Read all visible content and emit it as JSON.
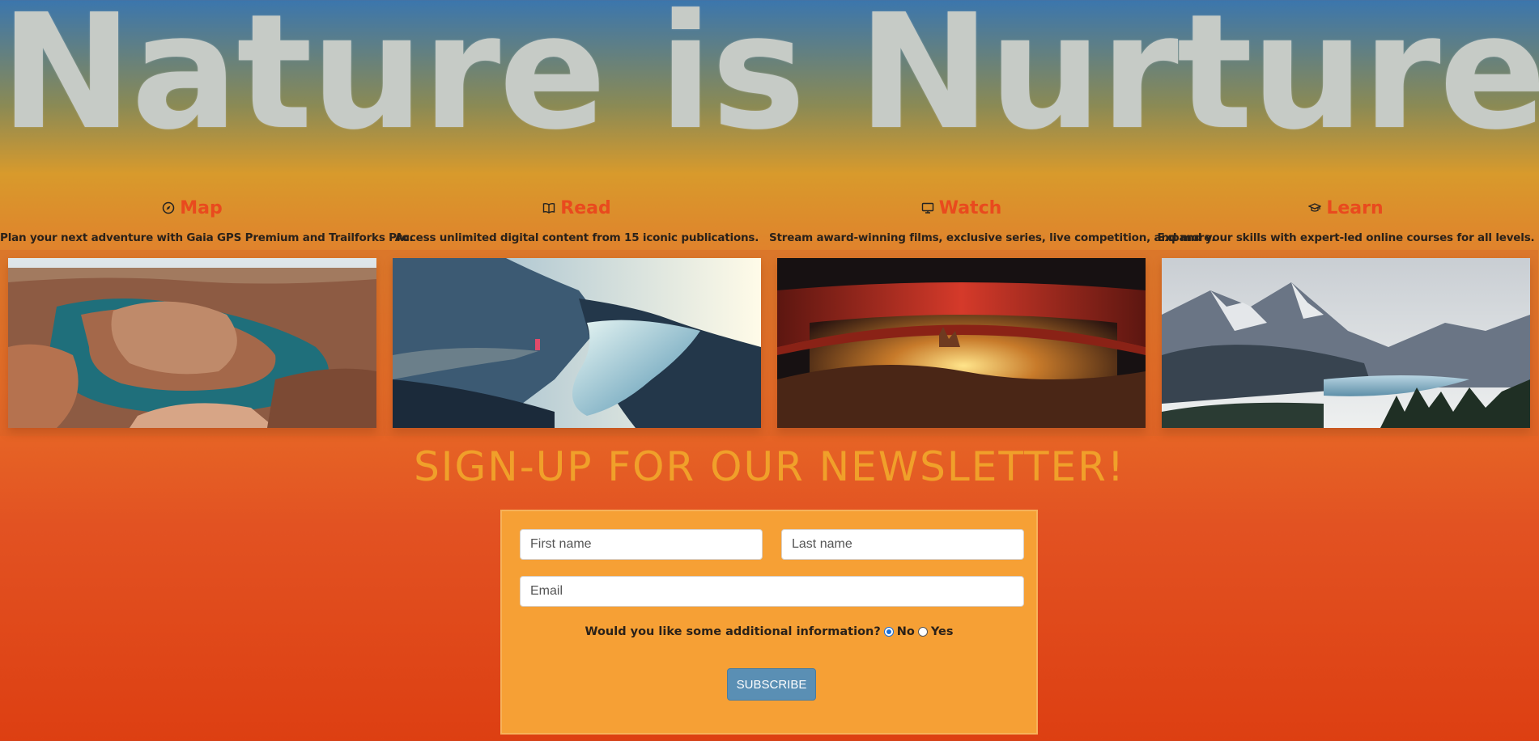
{
  "hero": {
    "title": "Nature is Nurture"
  },
  "cards": [
    {
      "title": "Map",
      "icon": "compass-icon",
      "description": "Plan your next adventure with Gaia GPS Premium and Trailforks Pro."
    },
    {
      "title": "Read",
      "icon": "book-icon",
      "description": "Access unlimited digital content from 15 iconic publications."
    },
    {
      "title": "Watch",
      "icon": "monitor-icon",
      "description": "Stream award-winning films, exclusive series, live competition, and more."
    },
    {
      "title": "Learn",
      "icon": "graduation-cap-icon",
      "description": "Expand your skills with expert-led online courses for all levels."
    }
  ],
  "newsletter": {
    "title": "SIGN-UP FOR OUR NEWSLETTER!",
    "first_name_placeholder": "First name",
    "last_name_placeholder": "Last name",
    "email_placeholder": "Email",
    "question": "Would you like some additional information?",
    "option_no": "No",
    "option_yes": "Yes",
    "selected_option": "No",
    "submit_label": "SUBSCRIBE"
  },
  "colors": {
    "card_title": "#e94a1e",
    "newsletter_title": "#f0a02a",
    "form_background": "#f6a035",
    "button": "#5a8fb4"
  }
}
